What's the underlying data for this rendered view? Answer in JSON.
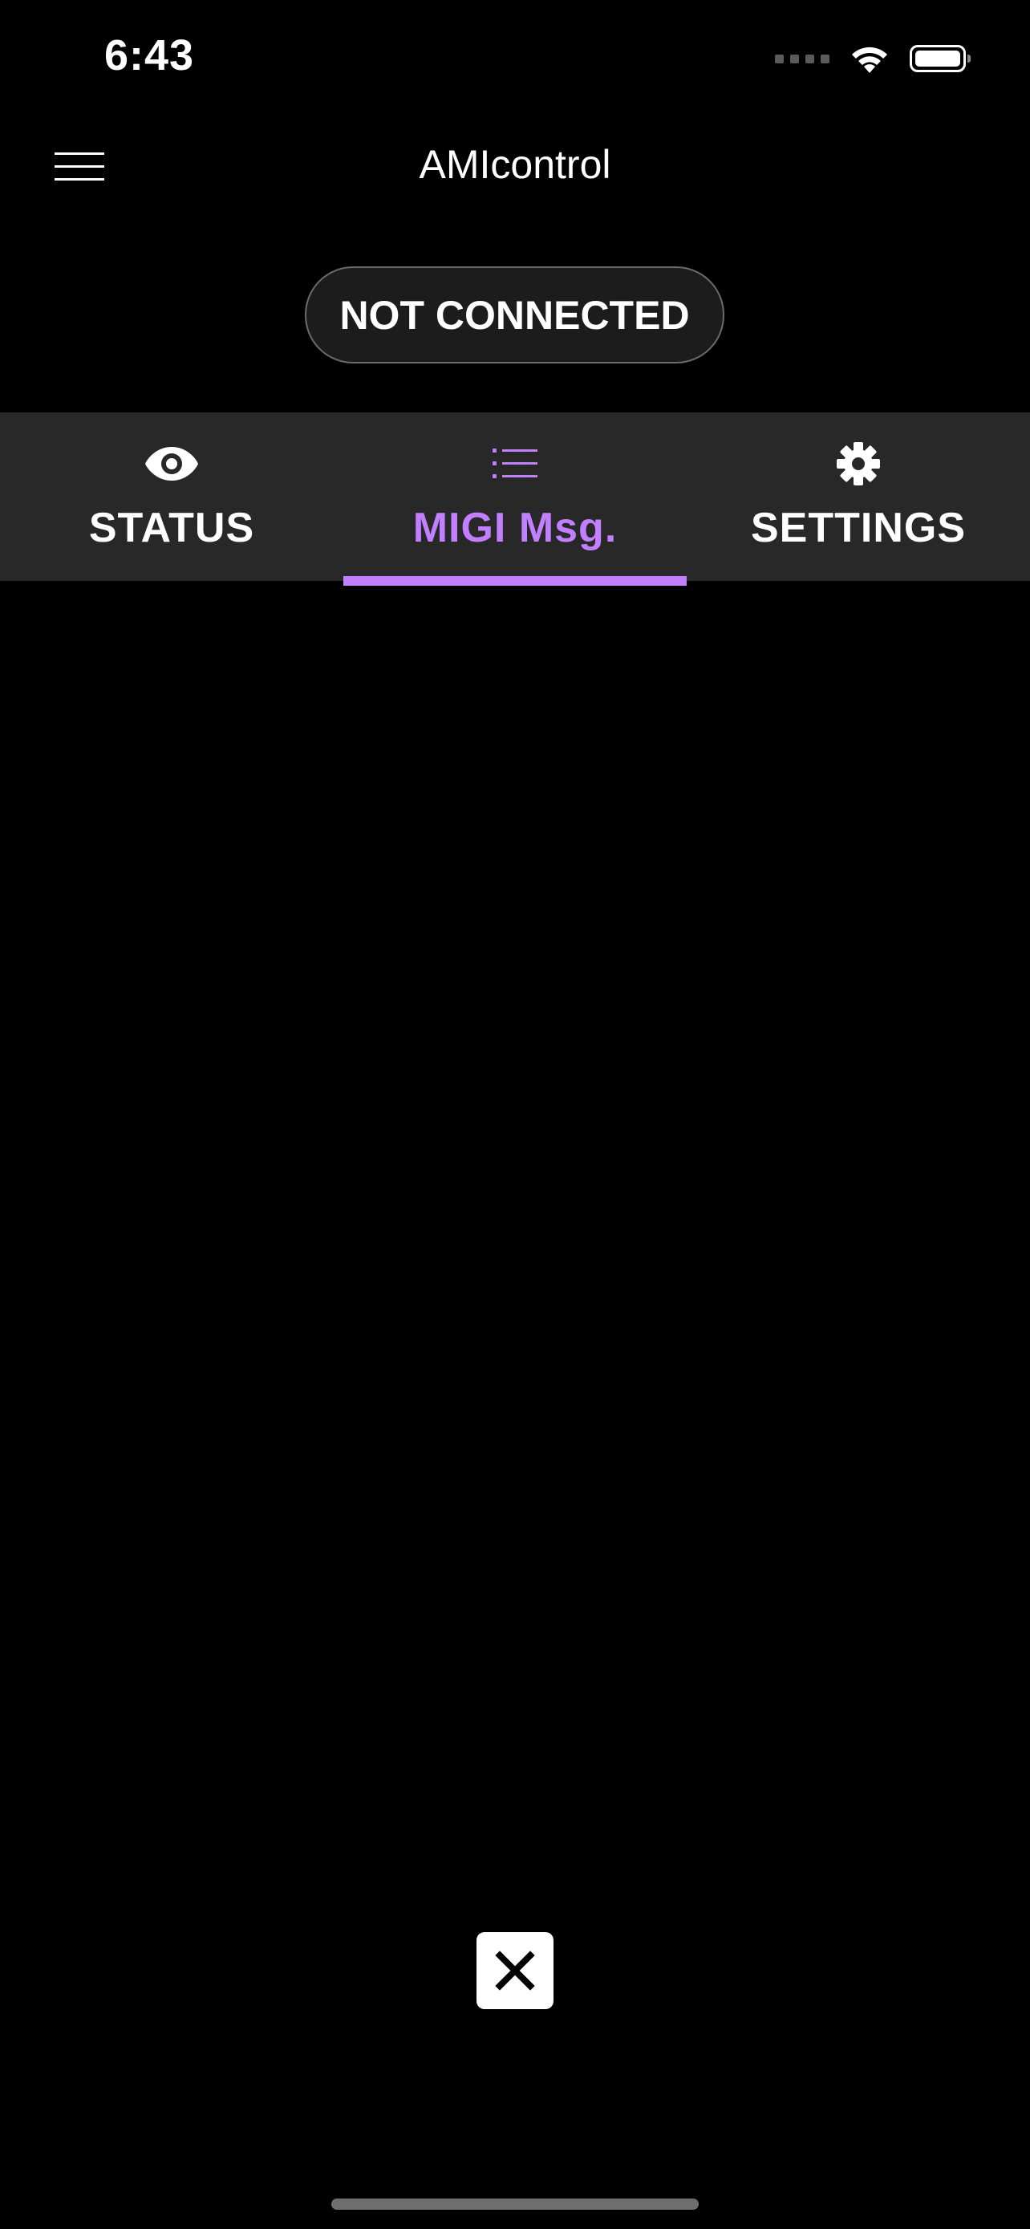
{
  "status_bar": {
    "time": "6:43"
  },
  "header": {
    "title": "AMIcontrol"
  },
  "connection": {
    "label": "NOT CONNECTED"
  },
  "tabs": [
    {
      "label": "STATUS",
      "icon": "eye-icon",
      "active": false
    },
    {
      "label": "MIGI Msg.",
      "icon": "list-icon",
      "active": true
    },
    {
      "label": "SETTINGS",
      "icon": "gear-icon",
      "active": false
    }
  ],
  "colors": {
    "accent": "#c27fff",
    "background": "#000000",
    "tab_bar": "#282828"
  },
  "close_button": {
    "icon": "close-icon"
  }
}
